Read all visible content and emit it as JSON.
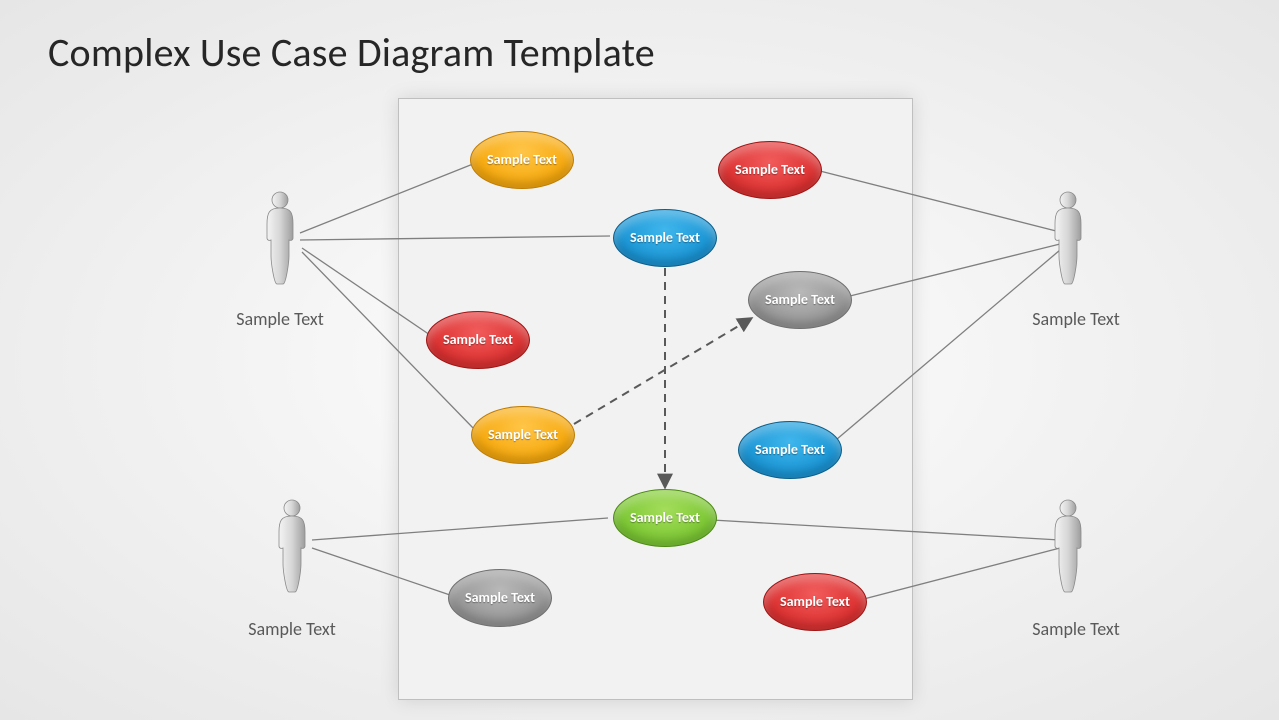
{
  "title": "Complex Use Case Diagram Template",
  "actors": {
    "top_left": {
      "label": "Sample Text"
    },
    "bottom_left": {
      "label": "Sample Text"
    },
    "top_right": {
      "label": "Sample Text"
    },
    "bottom_right": {
      "label": "Sample Text"
    }
  },
  "usecases": {
    "orange1": {
      "label": "Sample Text",
      "color": "#f5a300"
    },
    "red1": {
      "label": "Sample Text",
      "color": "#d82727"
    },
    "blue1": {
      "label": "Sample Text",
      "color": "#118dcf"
    },
    "gray1": {
      "label": "Sample Text",
      "color": "#8f8f8f"
    },
    "red2": {
      "label": "Sample Text",
      "color": "#d82727"
    },
    "orange2": {
      "label": "Sample Text",
      "color": "#f5a300"
    },
    "blue2": {
      "label": "Sample Text",
      "color": "#118dcf"
    },
    "green1": {
      "label": "Sample Text",
      "color": "#72c22a"
    },
    "gray2": {
      "label": "Sample Text",
      "color": "#8f8f8f"
    },
    "red3": {
      "label": "Sample Text",
      "color": "#d82727"
    }
  }
}
